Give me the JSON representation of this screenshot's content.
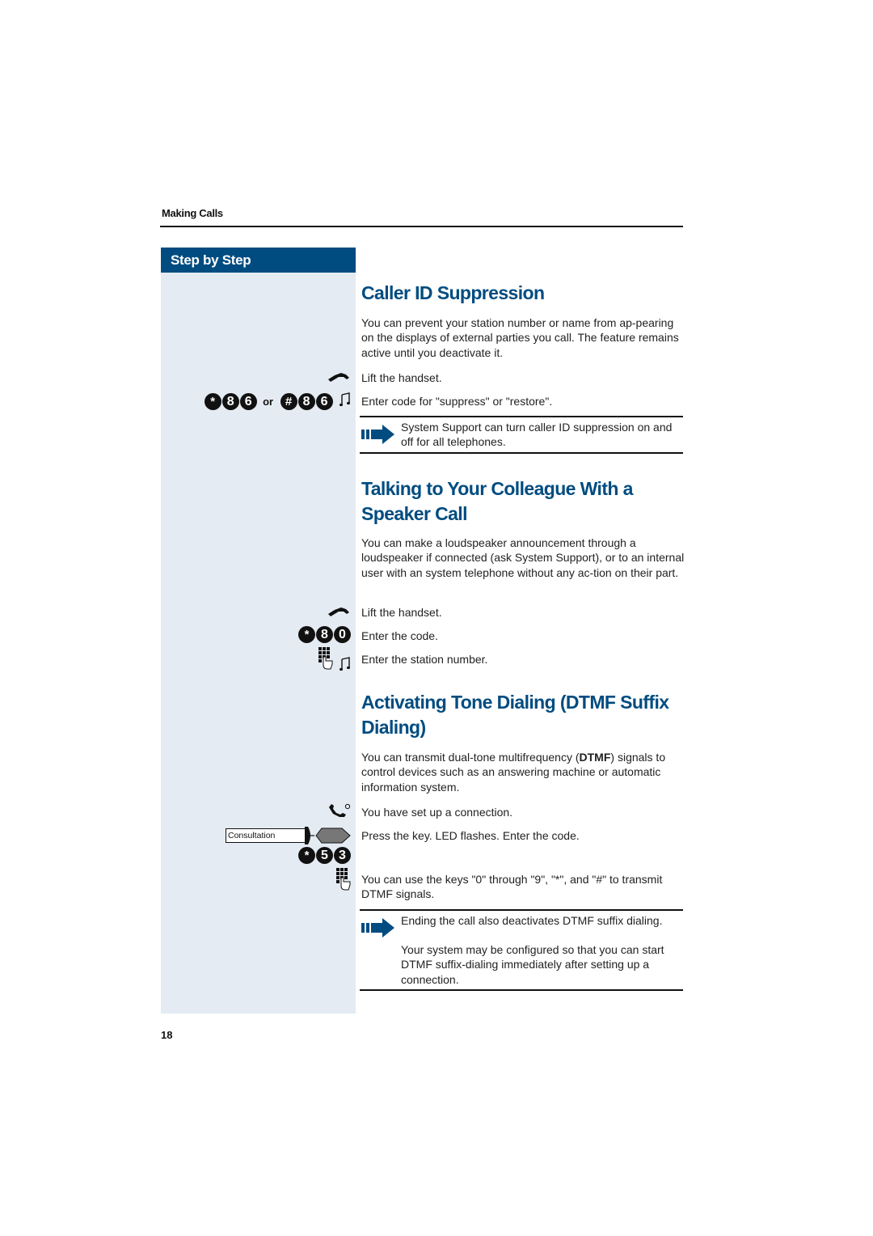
{
  "header": {
    "section_title": "Making Calls"
  },
  "sidebar": {
    "title": "Step by Step"
  },
  "sections": [
    {
      "title": "Caller ID Suppression",
      "intro": "You can prevent your station number or name from ap-pearing on the displays of external parties you call. The feature remains active until you deactivate it.",
      "steps": [
        {
          "icon": "lift-handset-icon",
          "text": "Lift the handset."
        },
        {
          "icon": "key-code",
          "keys_a": [
            "*",
            "8",
            "6"
          ],
          "or_label": "or",
          "keys_b": [
            "#",
            "8",
            "6"
          ],
          "text": "Enter code for \"suppress\" or \"restore\"."
        }
      ],
      "note": "System Support can turn caller ID suppression on and off for all telephones."
    },
    {
      "title_line1": "Talking to Your Colleague With a",
      "title_line2": "Speaker Call",
      "intro": "You can make a loudspeaker announcement through a loudspeaker if connected (ask System Support), or to an internal user with an system telephone without any ac-tion on their part.",
      "steps": [
        {
          "icon": "lift-handset-icon",
          "text": "Lift the handset."
        },
        {
          "icon": "key-code",
          "keys": [
            "*",
            "8",
            "0"
          ],
          "text": "Enter the code."
        },
        {
          "icon": "keypad-icon",
          "text": "Enter the station number."
        }
      ]
    },
    {
      "title_line1": "Activating Tone Dialing (DTMF Suffix",
      "title_line2": "Dialing)",
      "intro_before": "You can transmit dual-tone multifrequency (",
      "intro_bold": "DTMF",
      "intro_after": ") signals to control devices such as an answering machine or automatic information system.",
      "steps": [
        {
          "icon": "connected-handset-icon",
          "text": "You have set up a connection."
        },
        {
          "icon": "function-key",
          "key_label": "Consultation",
          "text": "Press the key. LED flashes. Enter the code."
        },
        {
          "icon": "key-code",
          "keys": [
            "*",
            "5",
            "3"
          ]
        },
        {
          "icon": "keypad-icon",
          "text": "You can use the keys \"0\" through \"9\", \"*\", and \"#\" to transmit DTMF signals."
        }
      ],
      "note_line1": "Ending the call also deactivates DTMF suffix dialing.",
      "note_line2": "Your system may be configured so that you can start DTMF suffix-dialing immediately after setting up a connection."
    }
  ],
  "footer": {
    "page_number": "18"
  },
  "colors": {
    "accent": "#004c80",
    "sidebar_bg": "#e4ebf2"
  }
}
